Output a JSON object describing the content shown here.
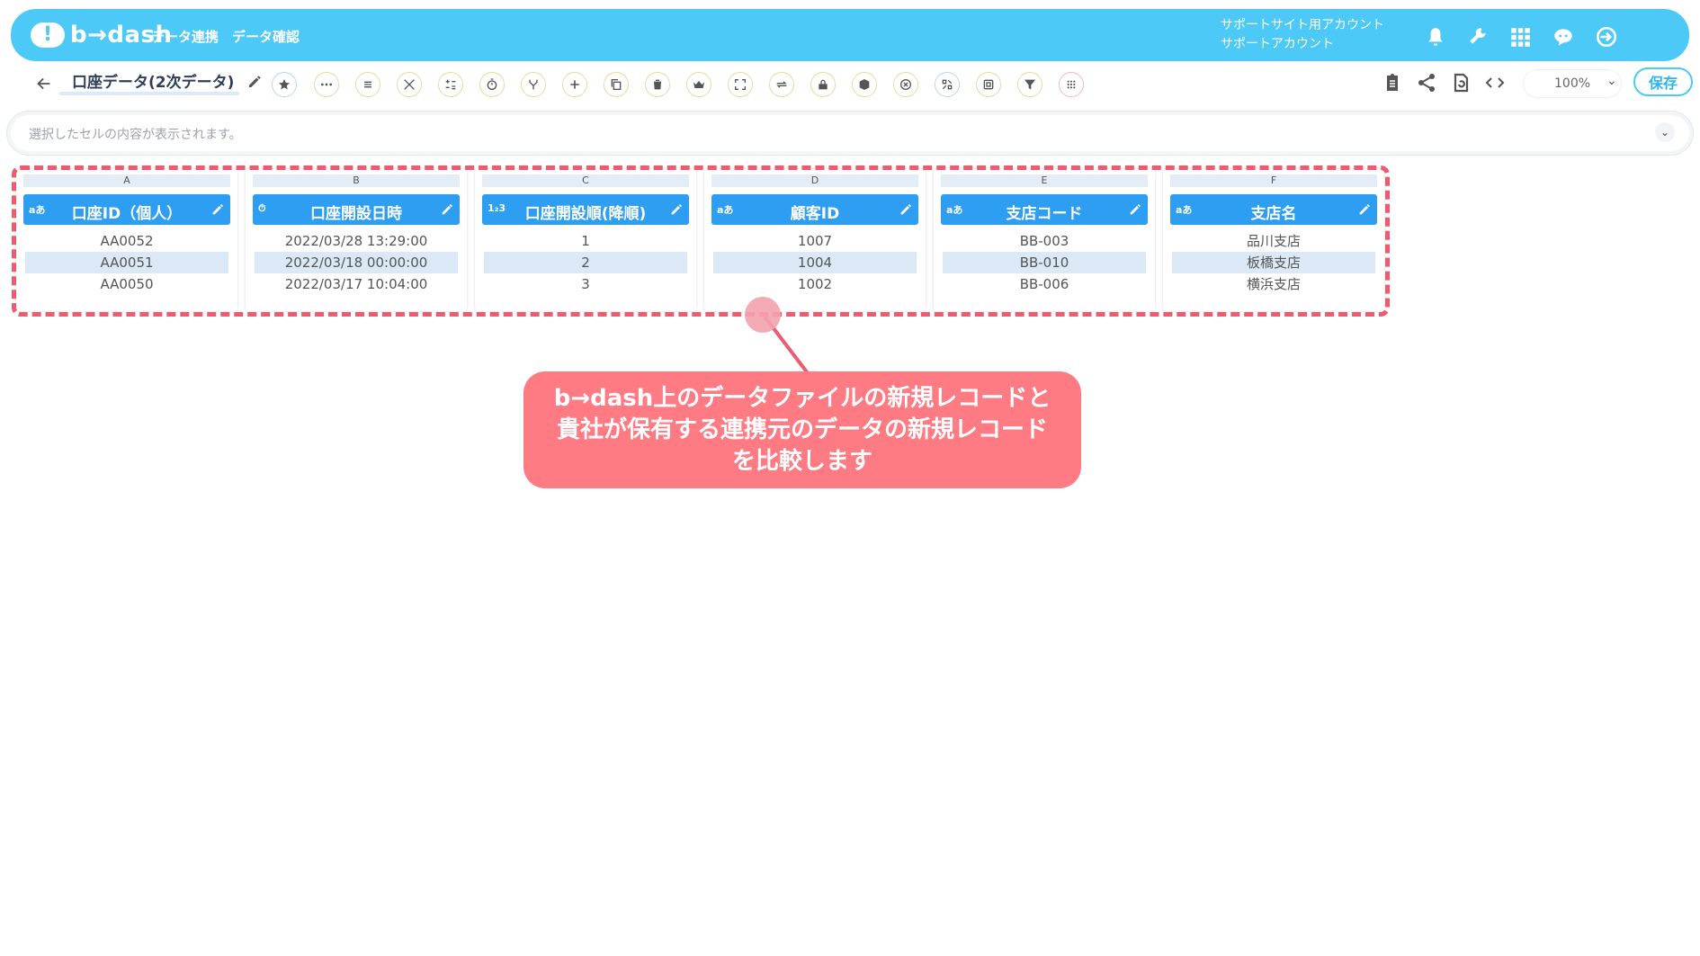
{
  "header": {
    "logo_text": "b→dash",
    "nav": [
      "データ連携",
      "データ確認"
    ],
    "account_line1": "サポートサイト用アカウント",
    "account_line2": "サポートアカウント",
    "icons": [
      "bell-icon",
      "wrench-icon",
      "grid-icon",
      "chat-icon",
      "logout-icon"
    ]
  },
  "toolbar": {
    "title": "口座データ(2次データ)",
    "zoom": "100%",
    "save_label": "保存",
    "tool_icons": [
      "star-icon",
      "more-icon",
      "list-icon",
      "tools-icon",
      "calc-icon",
      "timer-icon",
      "merge-icon",
      "add-icon",
      "copy-icon",
      "trash-icon",
      "crown-icon",
      "expand-icon",
      "swap-icon",
      "lock-icon",
      "package-icon",
      "close-circle-icon",
      "ai-icon",
      "box-icon",
      "filter-icon",
      "grid-dots-icon"
    ],
    "right_icons": [
      "clipboard-icon",
      "share-icon",
      "refresh-icon",
      "code-icon"
    ]
  },
  "cell_bar": {
    "placeholder": "選択したセルの内容が表示されます。"
  },
  "table": {
    "columns": [
      {
        "letter": "A",
        "type": "aあ",
        "name": "口座ID（個人）",
        "cells": [
          "AA0052",
          "AA0051",
          "AA0050"
        ]
      },
      {
        "letter": "B",
        "type": "⏱",
        "name": "口座開設日時",
        "cells": [
          "2022/03/28 13:29:00",
          "2022/03/18 00:00:00",
          "2022/03/17 10:04:00"
        ]
      },
      {
        "letter": "C",
        "type": "1₂3",
        "name": "口座開設順(降順)",
        "cells": [
          "1",
          "2",
          "3"
        ]
      },
      {
        "letter": "D",
        "type": "aあ",
        "name": "顧客ID",
        "cells": [
          "1007",
          "1004",
          "1002"
        ]
      },
      {
        "letter": "E",
        "type": "aあ",
        "name": "支店コード",
        "cells": [
          "BB-003",
          "BB-010",
          "BB-006"
        ]
      },
      {
        "letter": "F",
        "type": "aあ",
        "name": "支店名",
        "cells": [
          "品川支店",
          "板橋支店",
          "横浜支店"
        ]
      }
    ]
  },
  "callout": {
    "lines": [
      "b→dash上のデータファイルの新規レコードと",
      "貴社が保有する連携元のデータの新規レコード",
      "を比較します"
    ]
  },
  "colors": {
    "accent": "#4cc9f7",
    "header_blue": "#2d9ef2",
    "highlight": "#ef5a6e",
    "callout": "#ff7b84"
  }
}
